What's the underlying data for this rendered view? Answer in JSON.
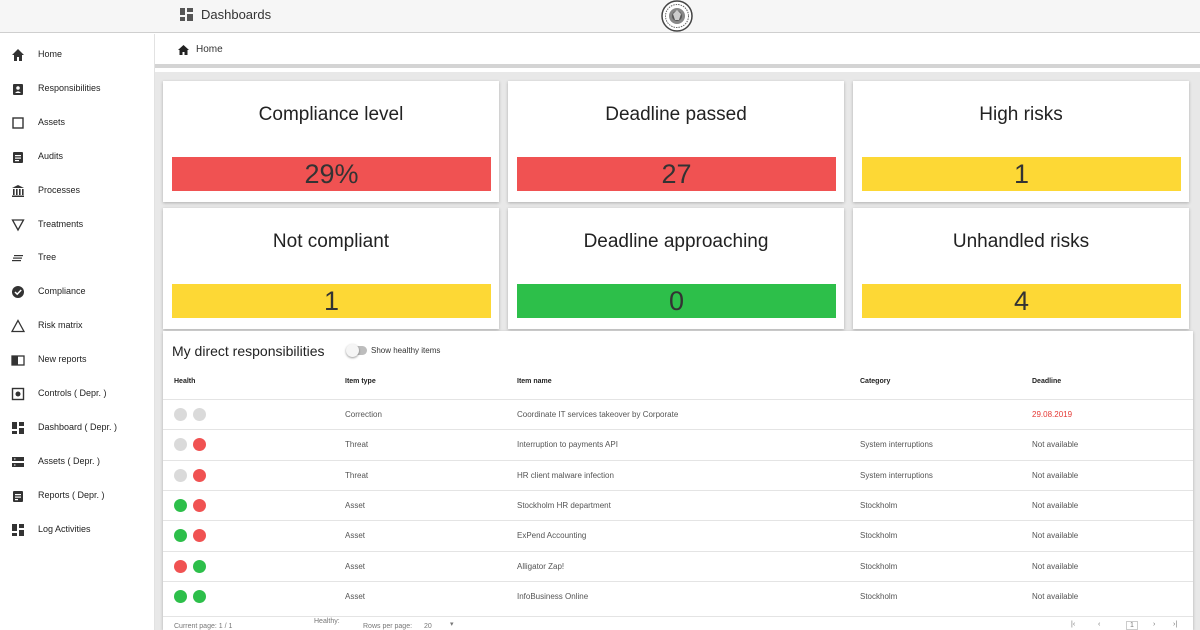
{
  "topbar": {
    "app_title": "Dashboards"
  },
  "breadcrumb": {
    "home": "Home"
  },
  "sidebar": {
    "items": [
      {
        "label": "Home",
        "icon": "home-icon"
      },
      {
        "label": "Responsibilities",
        "icon": "clipboard-person-icon"
      },
      {
        "label": "Assets",
        "icon": "square-icon"
      },
      {
        "label": "Audits",
        "icon": "clipboard-list-icon"
      },
      {
        "label": "Processes",
        "icon": "bank-icon"
      },
      {
        "label": "Treatments",
        "icon": "filter-triangle-icon"
      },
      {
        "label": "Tree",
        "icon": "lines-icon"
      },
      {
        "label": "Compliance",
        "icon": "check-circle-icon"
      },
      {
        "label": "Risk matrix",
        "icon": "warning-triangle-icon"
      },
      {
        "label": "New reports",
        "icon": "book-icon"
      },
      {
        "label": "Controls ( Depr. )",
        "icon": "control-icon"
      },
      {
        "label": "Dashboard ( Depr. )",
        "icon": "dashboard-icon"
      },
      {
        "label": "Assets ( Depr. )",
        "icon": "server-icon"
      },
      {
        "label": "Reports ( Depr. )",
        "icon": "report-icon"
      },
      {
        "label": "Log Activities",
        "icon": "dashboard-icon"
      }
    ]
  },
  "cards": [
    {
      "title": "Compliance level",
      "value": "29%",
      "color": "#f05252"
    },
    {
      "title": "Deadline passed",
      "value": "27",
      "color": "#f05252"
    },
    {
      "title": "High risks",
      "value": "1",
      "color": "#fdd835"
    },
    {
      "title": "Not compliant",
      "value": "1",
      "color": "#fdd835"
    },
    {
      "title": "Deadline approaching",
      "value": "0",
      "color": "#2dbf4a"
    },
    {
      "title": "Unhandled risks",
      "value": "4",
      "color": "#fdd835"
    }
  ],
  "responsibilities": {
    "heading": "My direct responsibilities",
    "toggle_label": "Show healthy items",
    "columns": [
      "Health",
      "Item type",
      "Item name",
      "Category",
      "Deadline"
    ],
    "rows": [
      {
        "health": [
          "gray",
          "gray"
        ],
        "type": "Correction",
        "name": "Coordinate IT services takeover by Corporate",
        "category": "",
        "deadline": "29.08.2019",
        "overdue": true
      },
      {
        "health": [
          "gray",
          "red"
        ],
        "type": "Threat",
        "name": "Interruption to payments API",
        "category": "System interruptions",
        "deadline": "Not available",
        "overdue": false
      },
      {
        "health": [
          "gray",
          "red"
        ],
        "type": "Threat",
        "name": "HR client malware infection",
        "category": "System interruptions",
        "deadline": "Not available",
        "overdue": false
      },
      {
        "health": [
          "green",
          "red"
        ],
        "type": "Asset",
        "name": "Stockholm HR department",
        "category": "Stockholm",
        "deadline": "Not available",
        "overdue": false
      },
      {
        "health": [
          "green",
          "red"
        ],
        "type": "Asset",
        "name": "ExPend Accounting",
        "category": "Stockholm",
        "deadline": "Not available",
        "overdue": false
      },
      {
        "health": [
          "red",
          "green"
        ],
        "type": "Asset",
        "name": "Alligator Zap!",
        "category": "Stockholm",
        "deadline": "Not available",
        "overdue": false
      },
      {
        "health": [
          "green",
          "green"
        ],
        "type": "Asset",
        "name": "InfoBusiness Online",
        "category": "Stockholm",
        "deadline": "Not available",
        "overdue": false
      }
    ],
    "footer": {
      "current_page": "Current page: 1 / 1",
      "healthy": "Healthy:",
      "rows_per_page": "Rows per page:",
      "rows_value": "20",
      "page": "1"
    }
  }
}
